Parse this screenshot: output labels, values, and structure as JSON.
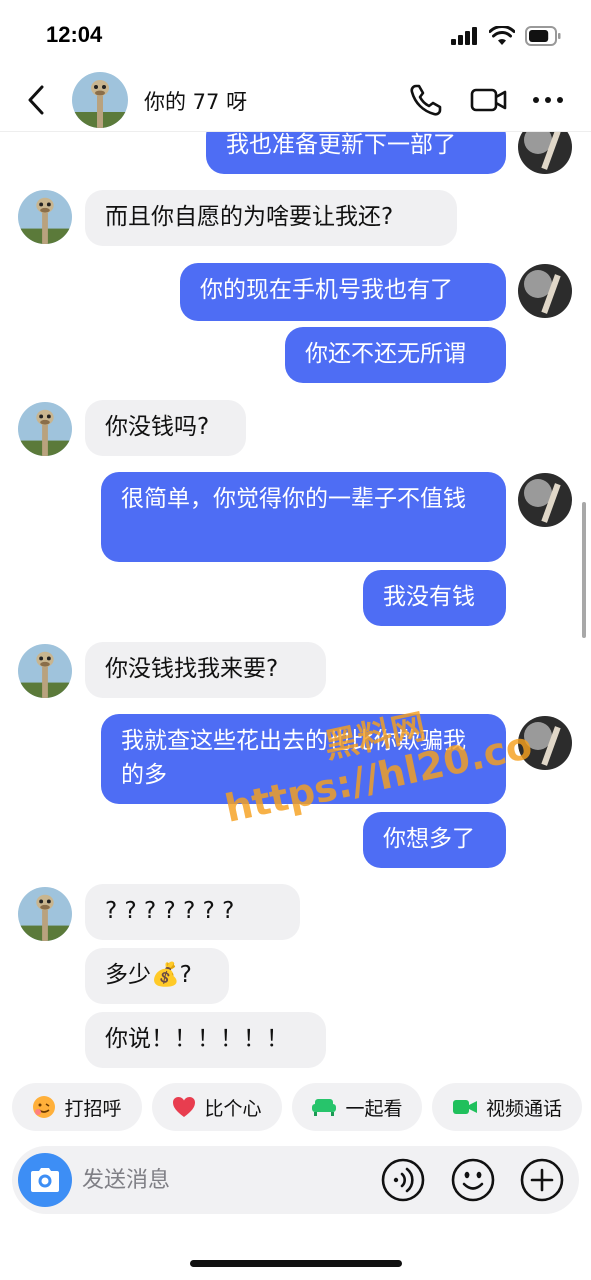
{
  "status_bar": {
    "time": "12:04",
    "battery_level": 0.8
  },
  "header": {
    "title": "你的 77 呀"
  },
  "messages": [
    {
      "side": "me",
      "text": "我也准备更新下一部了"
    },
    {
      "side": "them",
      "text": "而且你自愿的为啥要让我还?"
    },
    {
      "side": "me",
      "text": "你的现在手机号我也有了"
    },
    {
      "side": "me",
      "text": "你还不还无所谓"
    },
    {
      "side": "them",
      "text": "你没钱吗?"
    },
    {
      "side": "me",
      "text": "很简单，你觉得你的一辈子不值钱"
    },
    {
      "side": "me",
      "text": "我没有钱"
    },
    {
      "side": "them",
      "text": "你没钱找我来要?"
    },
    {
      "side": "me",
      "text": "我就查这些花出去的也比你欺骗我的多"
    },
    {
      "side": "me",
      "text": "你想多了"
    },
    {
      "side": "them",
      "text": "? ? ? ? ? ? ?"
    },
    {
      "side": "them",
      "text": "多少💰?"
    },
    {
      "side": "them",
      "text": "你说！！！！！！"
    }
  ],
  "watermark": {
    "line1": "黑料网",
    "line2": "https://hl20.co"
  },
  "quick_actions": [
    {
      "label": "打招呼",
      "icon": "wave-emoji-icon"
    },
    {
      "label": "比个心",
      "icon": "heart-icon"
    },
    {
      "label": "一起看",
      "icon": "sofa-icon"
    },
    {
      "label": "视频通话",
      "icon": "video-camera-icon"
    }
  ],
  "composer": {
    "placeholder": "发送消息"
  },
  "colors": {
    "my_bubble": "#4e6df4",
    "their_bubble": "#f0f0f2",
    "camera_button": "#3d8ef5"
  }
}
